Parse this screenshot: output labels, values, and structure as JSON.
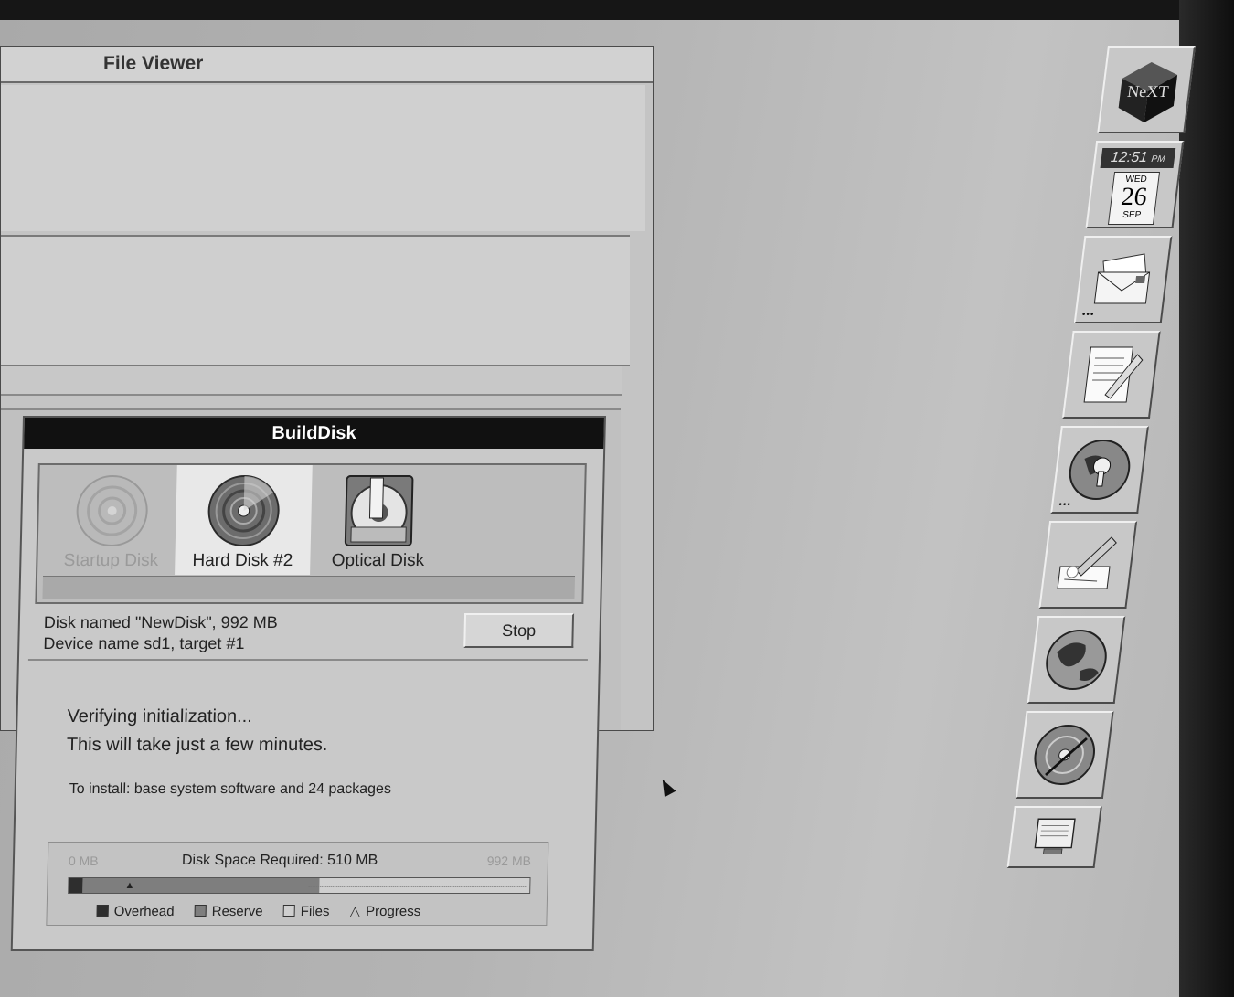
{
  "file_viewer": {
    "title": "File Viewer"
  },
  "builddisk": {
    "title": "BuildDisk",
    "disks": [
      {
        "label": "Startup Disk",
        "state": "disabled",
        "icon": "hard-disk-icon"
      },
      {
        "label": "Hard Disk #2",
        "state": "selected",
        "icon": "hard-disk-icon"
      },
      {
        "label": "Optical Disk",
        "state": "normal",
        "icon": "optical-disk-icon"
      }
    ],
    "disk_info_line1": "Disk named \"NewDisk\", 992 MB",
    "disk_info_line2": "Device name sd1, target #1",
    "stop_label": "Stop",
    "status_line1": "Verifying initialization...",
    "status_line2": "This will take just a few minutes.",
    "install_note": "To install: base system software and 24 packages",
    "space": {
      "min_label": "0 MB",
      "max_label": "992 MB",
      "required_label": "Disk Space Required: 510 MB",
      "total_mb": 992,
      "required_mb": 510,
      "overhead_mb": 30,
      "progress_mb": 130
    },
    "legend": {
      "overhead": "Overhead",
      "reserve": "Reserve",
      "files": "Files",
      "progress": "Progress"
    }
  },
  "dock": {
    "logo": "NeXT",
    "clock_time": "12:51",
    "clock_ampm": "PM",
    "clock_dow": "WED",
    "clock_day": "26",
    "clock_month": "SEP"
  }
}
